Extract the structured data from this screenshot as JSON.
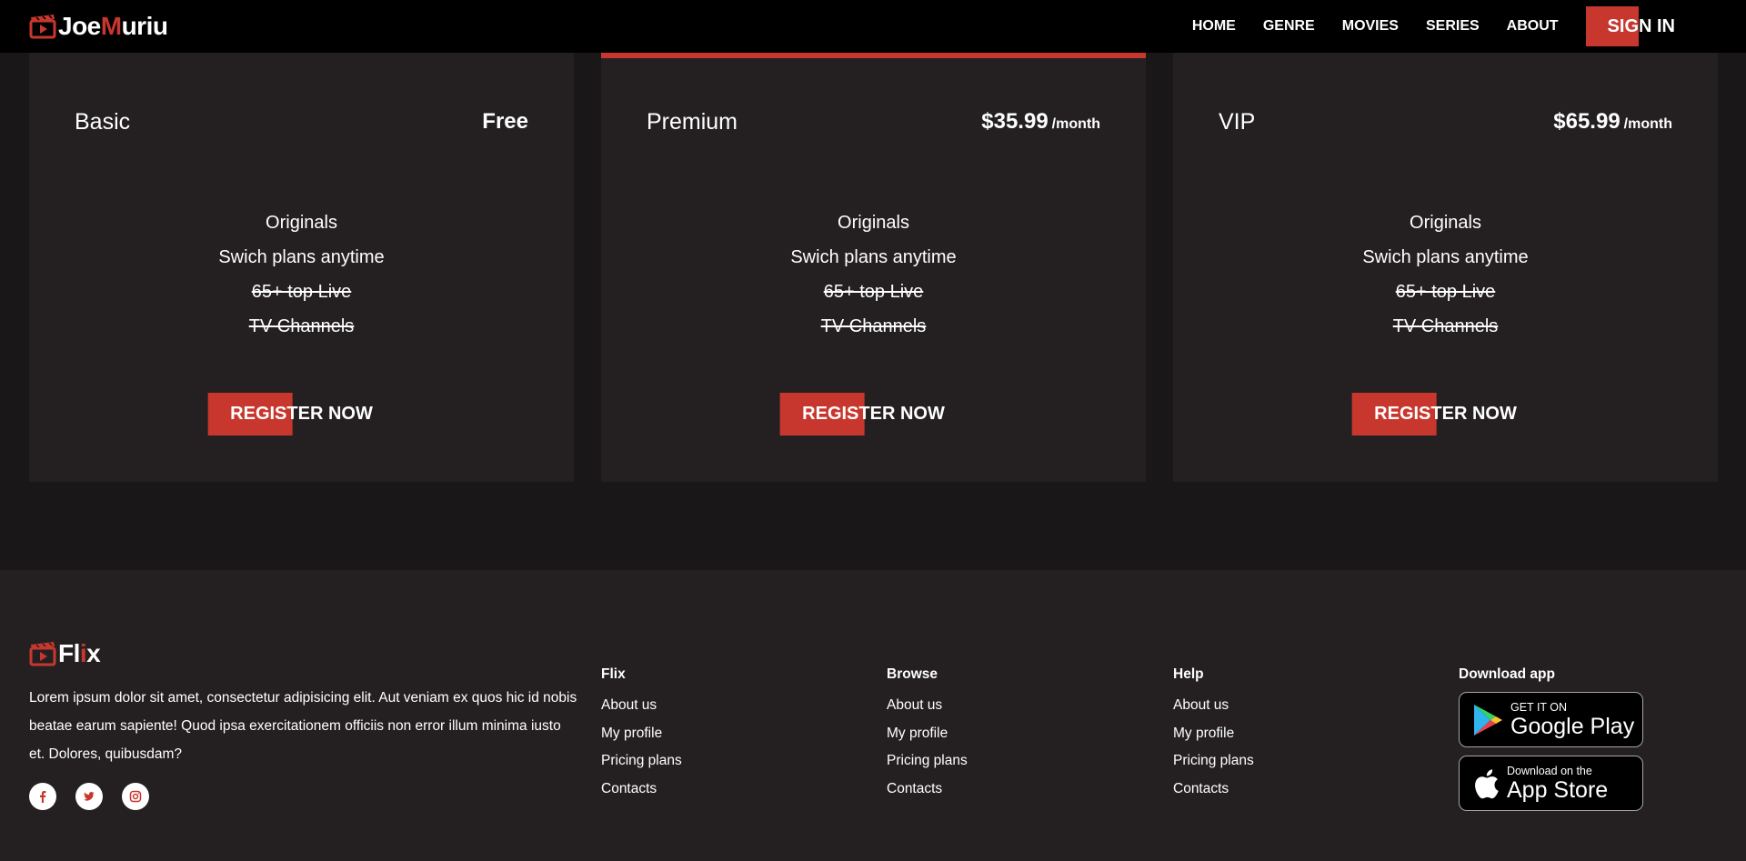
{
  "header": {
    "logo": {
      "part1": "Joe",
      "part2": "M",
      "part3": "uriu"
    },
    "nav": [
      "HOME",
      "GENRE",
      "MOVIES",
      "SERIES",
      "ABOUT"
    ],
    "signin": "SIGN IN"
  },
  "plans": [
    {
      "name": "Basic",
      "price": "Free",
      "per": "",
      "features": [
        "Originals",
        "Swich plans anytime",
        "65+ top Live",
        "TV Channels"
      ],
      "button": "REGISTER NOW"
    },
    {
      "name": "Premium",
      "price": "$35.99",
      "per": "/month",
      "features": [
        "Originals",
        "Swich plans anytime",
        "65+ top Live",
        "TV Channels"
      ],
      "button": "REGISTER NOW"
    },
    {
      "name": "VIP",
      "price": "$65.99",
      "per": "/month",
      "features": [
        "Originals",
        "Swich plans anytime",
        "65+ top Live",
        "TV Channels"
      ],
      "button": "REGISTER NOW"
    }
  ],
  "footer": {
    "logo": {
      "part1": "Fl",
      "part2": "i",
      "part3": "x"
    },
    "about": "Lorem ipsum dolor sit amet, consectetur adipisicing elit. Aut veniam ex quos hic id nobis beatae earum sapiente! Quod ipsa exercitationem officiis non error illum minima iusto et. Dolores, quibusdam?",
    "socials": [
      "facebook-icon",
      "twitter-icon",
      "instagram-icon"
    ],
    "columns": [
      {
        "title": "Flix",
        "links": [
          "About us",
          "My profile",
          "Pricing plans",
          "Contacts"
        ]
      },
      {
        "title": "Browse",
        "links": [
          "About us",
          "My profile",
          "Pricing plans",
          "Contacts"
        ]
      },
      {
        "title": "Help",
        "links": [
          "About us",
          "My profile",
          "Pricing plans",
          "Contacts"
        ]
      }
    ],
    "download": {
      "title": "Download app",
      "google": {
        "small": "GET IT ON",
        "big": "Google Play"
      },
      "apple": {
        "small": "Download on the",
        "big": "App Store"
      }
    }
  },
  "colors": {
    "accent": "#c8372d",
    "header_bg": "#000000",
    "card_bg": "#242022",
    "page_bg": "#1a1718"
  }
}
